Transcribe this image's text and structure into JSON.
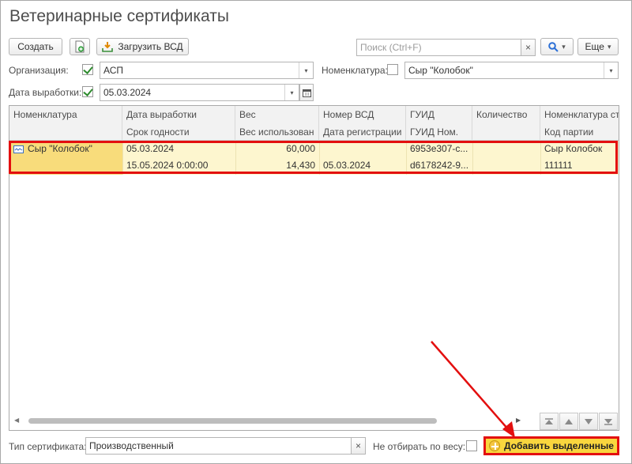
{
  "window": {
    "title": "Ветеринарные сертификаты"
  },
  "toolbar": {
    "create_label": "Создать",
    "load_vsd_label": "Загрузить ВСД",
    "search_placeholder": "Поиск (Ctrl+F)",
    "clear_glyph": "×",
    "search_glyph": "🔍",
    "more_label": "Еще",
    "dropdown_glyph": "▾"
  },
  "filters": {
    "organization_label": "Организация:",
    "organization_checked": true,
    "organization_value": "АСП",
    "nomenclature_label": "Номенклатура:",
    "nomenclature_checked": false,
    "nomenclature_value": "Сыр \"Колобок\"",
    "production_date_label": "Дата выработки:",
    "production_date_checked": true,
    "production_date_value": "05.03.2024"
  },
  "table": {
    "headers_top": [
      "Номенклатура",
      "Дата выработки",
      "Вес",
      "Номер ВСД",
      "ГУИД",
      "Количество",
      "Номенклатура строки"
    ],
    "headers_bottom": [
      "",
      "Срок годности",
      "Вес использован",
      "Дата регистрации",
      "ГУИД Ном.",
      "",
      "Код партии"
    ],
    "rows": [
      {
        "nomenclature": "Сыр \"Колобок\"",
        "production_date": "05.03.2024",
        "expiry": "15.05.2024 0:00:00",
        "weight": "60,000",
        "weight_used": "14,430",
        "vsd_number": "",
        "registration_date": "05.03.2024",
        "guid": "6953e307-c...",
        "guid_nom": "d6178242-9...",
        "quantity": "",
        "row_nomenclature": "Сыр Колобок",
        "batch_code": "111111"
      }
    ]
  },
  "footer": {
    "cert_type_label": "Тип сертификата:",
    "cert_type_value": "Производственный",
    "clear_glyph": "×",
    "no_weight_label": "Не отбирать по весу:",
    "no_weight_checked": false,
    "add_selected_label": "Добавить выделенные"
  },
  "colors": {
    "selected_row": "#fdf6cf",
    "selected_cell": "#f8dc7b",
    "highlight_border": "#e30f0f",
    "add_button": "#f9d63e"
  }
}
